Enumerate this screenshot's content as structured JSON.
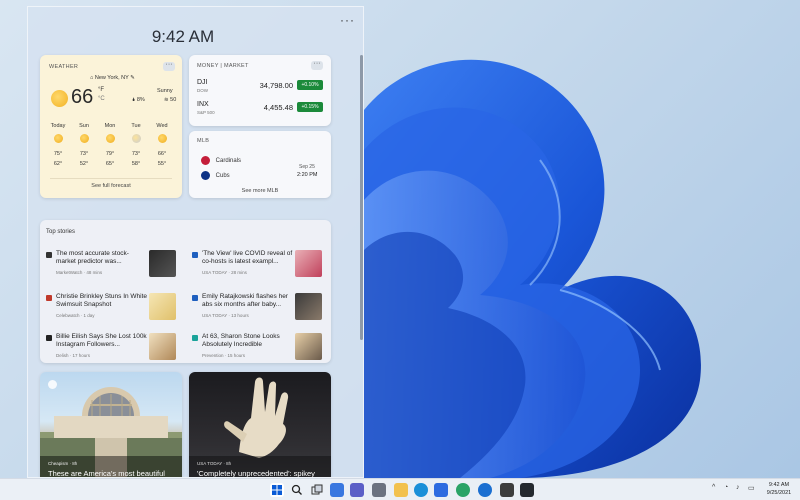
{
  "clock": "9:42 AM",
  "panel_menu": "···",
  "weather": {
    "title": "WEATHER",
    "location": "New York, NY",
    "temp": "66",
    "unit_f": "°F",
    "unit_c": "°C",
    "condition": "Sunny",
    "precip": "8%",
    "wind": "50",
    "forecast": [
      {
        "day": "Today",
        "hi": "75°",
        "lo": "62°",
        "icon": "sun-icon"
      },
      {
        "day": "Sun",
        "hi": "73°",
        "lo": "52°",
        "icon": "sun-icon"
      },
      {
        "day": "Mon",
        "hi": "79°",
        "lo": "65°",
        "icon": "sun-icon"
      },
      {
        "day": "Tue",
        "hi": "73°",
        "lo": "58°",
        "icon": "partly-cloudy-icon"
      },
      {
        "day": "Wed",
        "hi": "66°",
        "lo": "55°",
        "icon": "sun-icon"
      }
    ],
    "link": "See full forecast"
  },
  "money": {
    "title": "MONEY | MARKET",
    "stocks": [
      {
        "name": "DJI",
        "sub": "DOW",
        "value": "34,798.00",
        "change": "+0.10%"
      },
      {
        "name": "INX",
        "sub": "S&P 500",
        "value": "4,455.48",
        "change": "+0.15%"
      }
    ]
  },
  "mlb": {
    "title": "MLB",
    "team1": "Cardinals",
    "team2": "Cubs",
    "date": "Sep 25",
    "time": "2:20 PM",
    "link": "See more MLB"
  },
  "stories": {
    "title": "Top stories",
    "items": [
      {
        "headline": "The most accurate stock-market predictor was...",
        "source": "MarketWatch · 48 mins"
      },
      {
        "headline": "'The View' live COVID reveal of co-hosts is latest exampl...",
        "source": "USA TODAY · 28 mins"
      },
      {
        "headline": "Christie Brinkley Stuns In White Swimsuit Snapshot",
        "source": "Celebwatch · 1 day"
      },
      {
        "headline": "Emily Ratajkowski flashes her abs six months after baby...",
        "source": "USA TODAY · 13 hours"
      },
      {
        "headline": "Billie Eilish Says She Lost 100k Instagram Followers...",
        "source": "Delish · 17 hours"
      },
      {
        "headline": "At 63, Sharon Stone Looks Absolutely Incredible",
        "source": "Prevention · 15 hours"
      }
    ]
  },
  "card_arch": {
    "source": "Cheapism · 8h",
    "caption": "These are America's most beautiful"
  },
  "card_hand": {
    "source": "USA TODAY · 8h",
    "caption": "'Completely unprecedented': spikey"
  },
  "taskbar": {
    "time": "9:42 AM",
    "date": "9/25/2021",
    "tray_chevron": "^"
  },
  "colors": {
    "accent": "#0a5bd6",
    "stock_up": "#1b8a3a",
    "weather_card": "#fbf3d9"
  }
}
